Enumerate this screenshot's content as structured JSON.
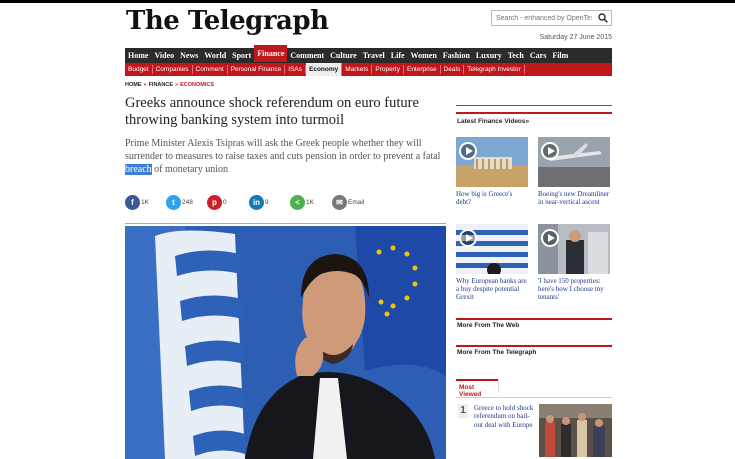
{
  "site": {
    "masthead": "The Telegraph",
    "search_placeholder": "Search - enhanced by OpenText",
    "date": "Saturday 27 June 2015"
  },
  "nav_primary": [
    "Home",
    "Video",
    "News",
    "World",
    "Sport",
    "Finance",
    "Comment",
    "Culture",
    "Travel",
    "Life",
    "Women",
    "Fashion",
    "Luxury",
    "Tech",
    "Cars",
    "Film"
  ],
  "nav_primary_active": "Finance",
  "nav_secondary": [
    "Budget",
    "Companies",
    "Comment",
    "Personal Finance",
    "ISAs",
    "Economy",
    "Markets",
    "Property",
    "Enterprise",
    "Deals",
    "Telegraph Investor"
  ],
  "nav_secondary_active": "Economy",
  "breadcrumb": [
    "HOME",
    "FINANCE",
    "ECONOMICS"
  ],
  "article": {
    "headline": "Greeks announce shock referendum on euro future throwing banking system into turmoil",
    "standfirst_before": "Prime Minister Alexis Tsipras will ask the Greek people whether they will surrender to measures to raise taxes and cuts pension in order to prevent a fatal ",
    "standfirst_highlight": "breach",
    "standfirst_after": " of monetary union"
  },
  "share": {
    "facebook": "1K",
    "twitter": "248",
    "pinterest": "0",
    "linkedin": "9",
    "share": "1K",
    "email": "Email"
  },
  "sidebar": {
    "videos_title": "Latest Finance Videos»",
    "videos": [
      {
        "caption": "How big is Greece's debt?"
      },
      {
        "caption": "Boeing's new Dreamliner in near-vertical ascent"
      },
      {
        "caption": "Why European banks are a buy despite potential Grexit"
      },
      {
        "caption": "'I have 150 properties: here's how I choose my tenants'"
      }
    ],
    "more_web": "More From The Web",
    "more_telegraph": "More From The Telegraph",
    "most_viewed_tab": "Most Viewed",
    "most_viewed": [
      {
        "rank": "1",
        "title": "Greece to hold shock referendum on bail-out deal with Europe"
      }
    ]
  },
  "colors": {
    "brand_red": "#c0171d",
    "nav_dark": "#2b2b2b",
    "link_blue": "#1a3a8a",
    "highlight": "#3d7fd6"
  }
}
